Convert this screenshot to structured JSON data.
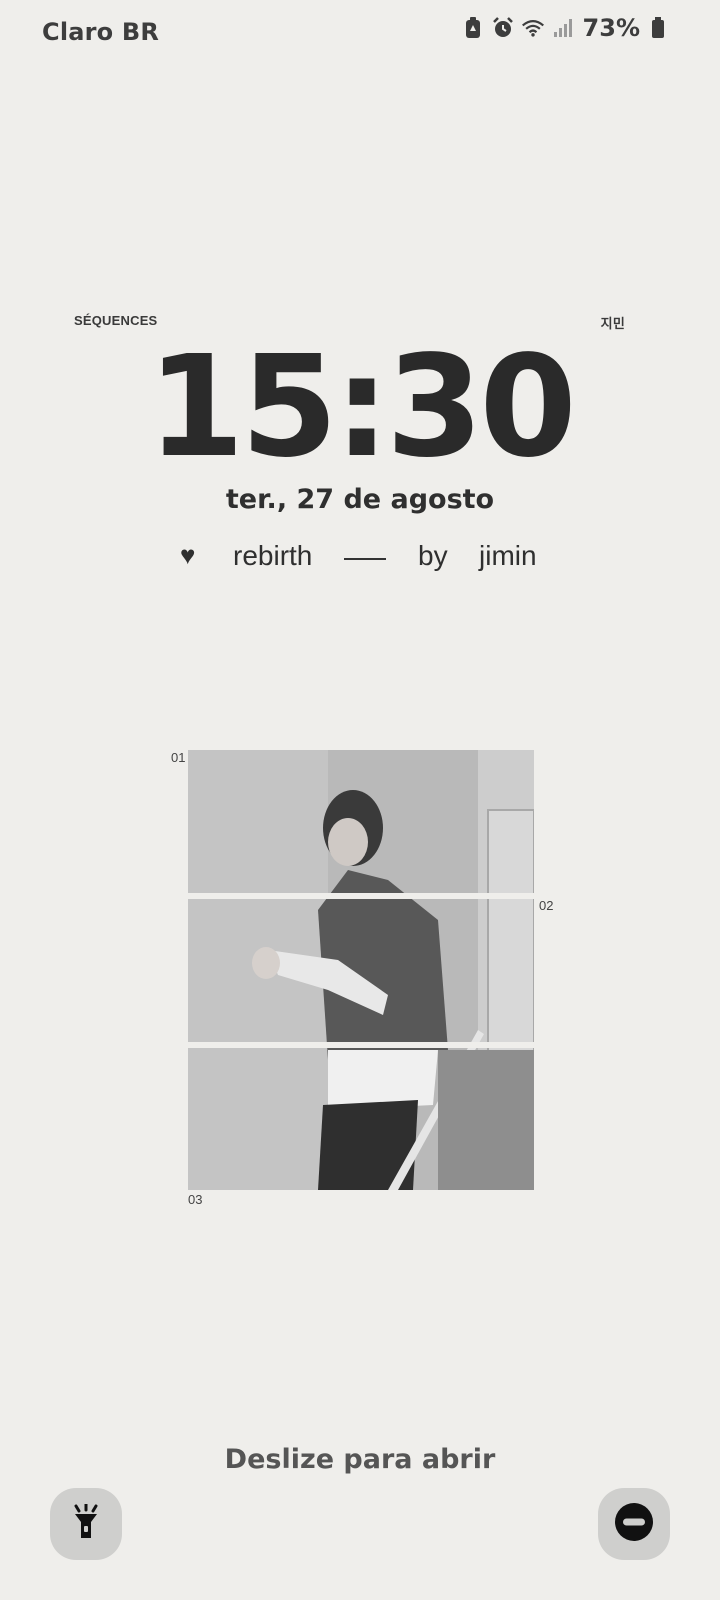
{
  "status_bar": {
    "carrier": "Claro BR",
    "battery_percent": "73%",
    "icons": [
      "battery-saver-icon",
      "alarm-icon",
      "wifi-icon",
      "signal-icon",
      "battery-icon"
    ]
  },
  "widget": {
    "left_label": "SÉQUENCES",
    "right_label": "지민",
    "time": "15:30",
    "date": "ter., 27 de agosto",
    "subtitle": {
      "heart": "♥",
      "word1": "rebirth",
      "word2": "by",
      "word3": "jimin"
    }
  },
  "photo": {
    "index_labels": [
      "01",
      "02",
      "03"
    ]
  },
  "bottom": {
    "swipe_text": "Deslize para abrir",
    "left_shortcut_icon": "flashlight-icon",
    "right_shortcut_icon": "do-not-disturb-icon"
  },
  "colors": {
    "background": "#efeeeb",
    "text": "#2c2c2c",
    "button_bg": "#cfcfcd"
  }
}
